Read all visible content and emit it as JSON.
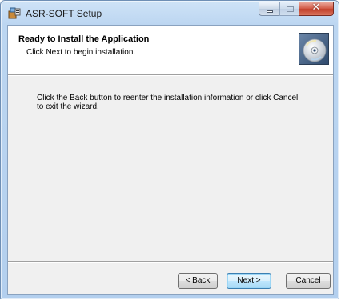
{
  "window": {
    "title": "ASR-SOFT Setup"
  },
  "titlebar": {
    "icons": [
      "setup-app-icon"
    ],
    "buttons": [
      {
        "name": "minimize",
        "icon": "minimize-icon"
      },
      {
        "name": "maximize",
        "icon": "maximize-icon",
        "enabled": false
      },
      {
        "name": "close",
        "icon": "close-icon"
      }
    ]
  },
  "banner": {
    "title": "Ready to Install the Application",
    "subtitle": "Click Next to begin installation.",
    "icon": "cd-disc-icon"
  },
  "body": {
    "text": "Click the Back button to reenter the installation information or click Cancel to exit the wizard."
  },
  "buttons": {
    "back": "< Back",
    "next": "Next >",
    "cancel": "Cancel"
  },
  "colors": {
    "titlebar": "#bcd6f1",
    "client": "#f0f0f0",
    "banner": "#ffffff",
    "close_button": "#c2402b",
    "default_button_border": "#3c7fb1"
  }
}
